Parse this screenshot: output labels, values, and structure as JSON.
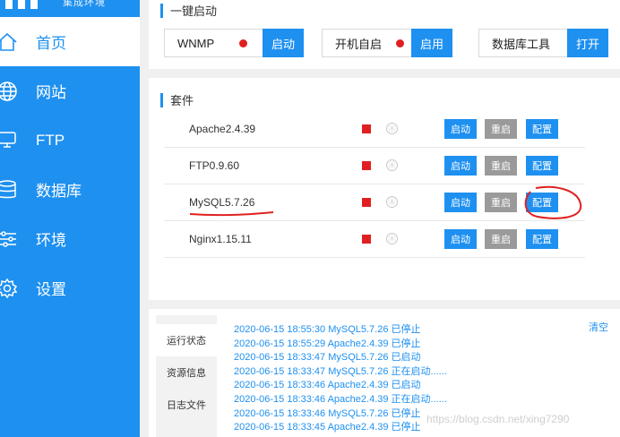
{
  "brand": {
    "text": "集成环境"
  },
  "nav": [
    {
      "label": "首页",
      "icon": "home-icon"
    },
    {
      "label": "网站",
      "icon": "globe-icon"
    },
    {
      "label": "FTP",
      "icon": "server-icon"
    },
    {
      "label": "数据库",
      "icon": "database-icon"
    },
    {
      "label": "环境",
      "icon": "sliders-icon"
    },
    {
      "label": "设置",
      "icon": "gear-icon"
    }
  ],
  "quick_start": {
    "title": "一键启动",
    "items": [
      {
        "label": "WNMP",
        "button": "启动",
        "status_color": "#e02020"
      },
      {
        "label": "开机自启",
        "button": "启用",
        "status_color": "#e02020"
      },
      {
        "label": "数据库工具",
        "button": "打开"
      }
    ]
  },
  "suite": {
    "title": "套件",
    "buttons": {
      "start": "启动",
      "restart": "重启",
      "config": "配置"
    },
    "auto_icon": "Ⓐ",
    "rows": [
      {
        "name": "Apache2.4.39"
      },
      {
        "name": "FTP0.9.60"
      },
      {
        "name": "MySQL5.7.26"
      },
      {
        "name": "Nginx1.15.11"
      }
    ]
  },
  "log_panel": {
    "tabs": [
      "运行状态",
      "资源信息",
      "日志文件"
    ],
    "clear": "清空",
    "lines": [
      "2020-06-15 18:55:30 MySQL5.7.26 已停止",
      "2020-06-15 18:55:29 Apache2.4.39 已停止",
      "2020-06-15 18:33:47 MySQL5.7.26 已启动",
      "2020-06-15 18:33:47 MySQL5.7.26 正在启动......",
      "2020-06-15 18:33:46 Apache2.4.39 已启动",
      "2020-06-15 18:33:46 Apache2.4.39 正在启动......",
      "2020-06-15 18:33:46 MySQL5.7.26 已停止",
      "2020-06-15 18:33:45 Apache2.4.39 已停止"
    ]
  },
  "watermark": "https://blog.csdn.net/xing7290",
  "colors": {
    "accent": "#1e90f0",
    "status_stopped": "#e02020",
    "restart_button": "#9a9a9a",
    "annotation": "#e02020"
  }
}
